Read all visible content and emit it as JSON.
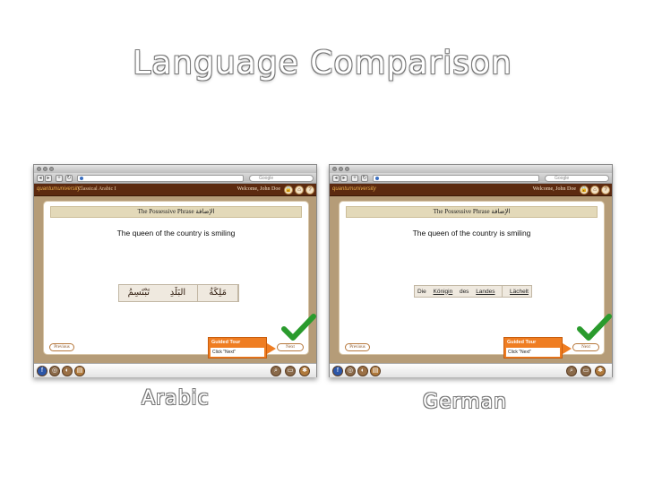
{
  "slide": {
    "title": "Language Comparison",
    "caption_left": "Arabic",
    "caption_right": "German"
  },
  "browser_chrome": {
    "search_placeholder": "Google",
    "nav_back": "◂",
    "nav_forward": "▸",
    "nav_add": "+",
    "nav_reload": "↻"
  },
  "app": {
    "logo": "quantumuniversity",
    "course_left": "Classical Arabic I",
    "welcome": "Welcome, John Doe",
    "home_icon": "house-icon",
    "help_icon": "question-icon",
    "lock_icon": "lock-icon"
  },
  "lesson": {
    "header": "The Possessive Phrase  الإضافة",
    "sentence": "The queen of the country is smiling",
    "previous": "Previous",
    "next": "Next",
    "tour_title": "Guided Tour",
    "tour_body": "Click \"Next\""
  },
  "arabic_words": [
    "مَلِكَةُ",
    "البَلَدِ",
    "تَبْتَسِمُ"
  ],
  "german_words": {
    "w1": "Die",
    "w2": "Königin",
    "w3": "des",
    "w4": "Landes",
    "w5": "Lächelt"
  },
  "colors": {
    "app_header": "#5c2a10",
    "content_bg": "#b59c78",
    "tour": "#ef7d22",
    "check": "#2a9b2d"
  },
  "bottom_icons_left": [
    "facebook-icon",
    "compass-icon",
    "globe-icon",
    "book-icon"
  ],
  "bottom_icons_right": [
    "search-icon",
    "chat-icon",
    "settings-icon"
  ]
}
